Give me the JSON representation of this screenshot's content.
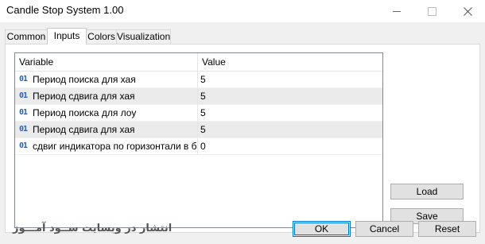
{
  "window": {
    "title": "Candle Stop System 1.00",
    "minimize_icon": "minimize-icon",
    "maximize_icon": "maximize-icon",
    "close_icon": "close-icon"
  },
  "tabs": [
    {
      "label": "Common",
      "active": false
    },
    {
      "label": "Inputs",
      "active": true
    },
    {
      "label": "Colors",
      "active": false
    },
    {
      "label": "Visualization",
      "active": false
    }
  ],
  "grid": {
    "columns": [
      "Variable",
      "Value"
    ],
    "type_icon_glyph": "01",
    "rows": [
      {
        "variable": "Период поиска для хая",
        "value": "5"
      },
      {
        "variable": "Период сдвига для хая",
        "value": "5"
      },
      {
        "variable": "Период поиска для лоу",
        "value": "5"
      },
      {
        "variable": "Период сдвига для хая",
        "value": "5"
      },
      {
        "variable": "сдвиг индикатора по горизонтали в б…",
        "value": "0"
      }
    ]
  },
  "side_buttons": {
    "load": "Load",
    "save": "Save"
  },
  "footer": {
    "watermark": "انتشار در وبسایت  ســود آمـــوز",
    "ok": "OK",
    "cancel": "Cancel",
    "reset": "Reset"
  },
  "colors": {
    "accent": "#0078d7",
    "type_icon": "#2b5fb3",
    "alt_row": "#ebebeb"
  }
}
